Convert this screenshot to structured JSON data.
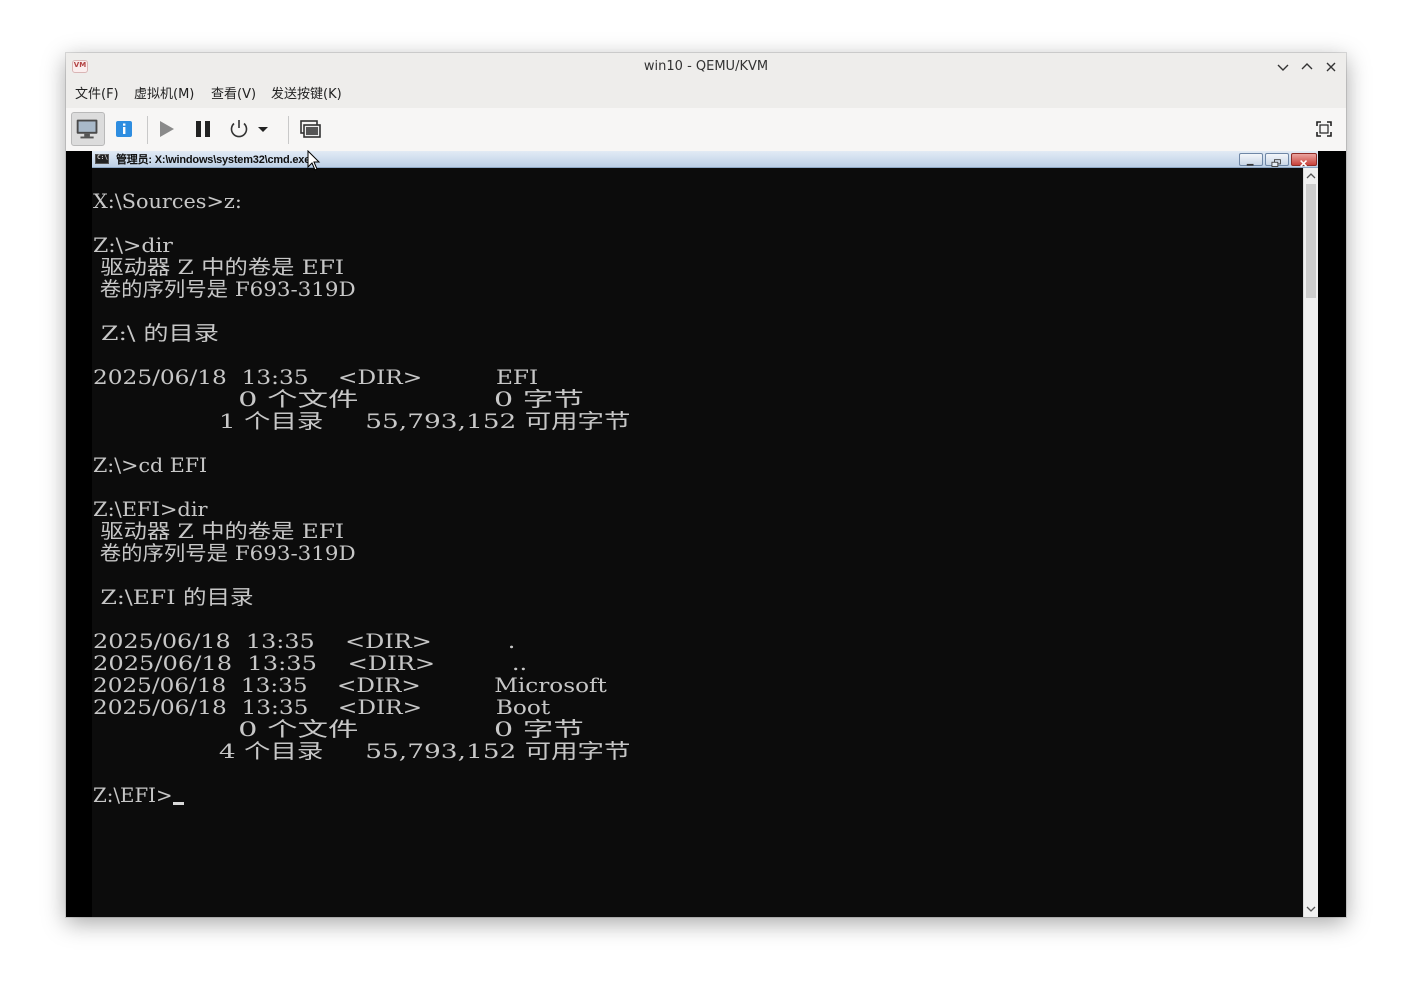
{
  "window": {
    "title": "win10 - QEMU/KVM",
    "app_icon_text": "VM"
  },
  "menubar": {
    "items": [
      "文件(F)",
      "虚拟机(M)",
      "查看(V)",
      "发送按键(K)"
    ]
  },
  "toolbar": {
    "buttons": [
      "console",
      "details",
      "run",
      "pause",
      "shutdown",
      "shutdown-menu",
      "snapshots",
      "fullscreen"
    ],
    "active": "console"
  },
  "cmd": {
    "title": "管理员: X:\\windows\\system32\\cmd.exe",
    "icon_text": "C:\\",
    "lines": [
      "",
      "X:\\Sources>z:",
      "",
      "Z:\\>dir",
      " 驱动器 Z 中的卷是 EFI",
      " 卷的序列号是 F693-319D",
      "",
      " Z:\\ 的目录",
      "",
      "2025/06/18  13:35    <DIR>          EFI",
      "               0 个文件              0 字节",
      "               1 个目录     55,793,152 可用字节",
      "",
      "Z:\\>cd EFI",
      "",
      "Z:\\EFI>dir",
      " 驱动器 Z 中的卷是 EFI",
      " 卷的序列号是 F693-319D",
      "",
      " Z:\\EFI 的目录",
      "",
      "2025/06/18  13:35    <DIR>          .",
      "2025/06/18  13:35    <DIR>          ..",
      "2025/06/18  13:35    <DIR>          Microsoft",
      "2025/06/18  13:35    <DIR>          Boot",
      "               0 个文件              0 字节",
      "               4 个目录     55,793,152 可用字节",
      "",
      "Z:\\EFI>"
    ]
  },
  "colors": {
    "console_bg": "#0c0c0c",
    "console_text": "#c7c7c7",
    "info_button": "#2e8de0"
  }
}
